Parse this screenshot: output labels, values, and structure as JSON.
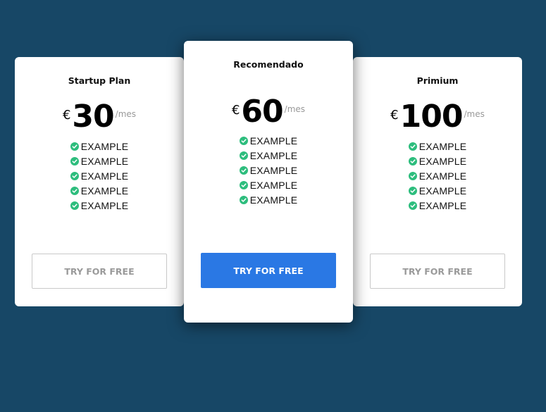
{
  "colors": {
    "background": "#174766",
    "accent": "#2a78e4",
    "check": "#2dbd7d"
  },
  "plans": [
    {
      "title": "Startup Plan",
      "currency": "€",
      "amount": "30",
      "period": "/mes",
      "features": [
        "EXAMPLE",
        "EXAMPLE",
        "EXAMPLE",
        "EXAMPLE",
        "EXAMPLE"
      ],
      "cta": "TRY FOR FREE"
    },
    {
      "title": "Recomendado",
      "currency": "€",
      "amount": "60",
      "period": "/mes",
      "features": [
        "EXAMPLE",
        "EXAMPLE",
        "EXAMPLE",
        "EXAMPLE",
        "EXAMPLE"
      ],
      "cta": "TRY FOR FREE"
    },
    {
      "title": "Primium",
      "currency": "€",
      "amount": "100",
      "period": "/mes",
      "features": [
        "EXAMPLE",
        "EXAMPLE",
        "EXAMPLE",
        "EXAMPLE",
        "EXAMPLE"
      ],
      "cta": "TRY FOR FREE"
    }
  ]
}
